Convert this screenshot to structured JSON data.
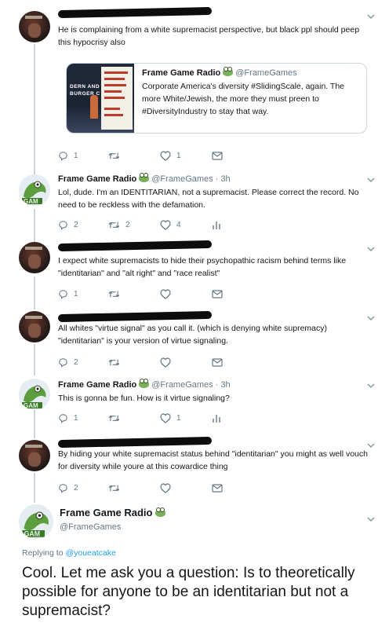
{
  "tweets": [
    {
      "text": "He is complaining from a white supremacist perspective, but black ppl should peep this hypocrisy also",
      "counts": {
        "reply": "1",
        "retweet": "",
        "like": "1"
      }
    },
    {
      "name": "Frame Game Radio",
      "handle": "@FrameGames · 3h",
      "text": "Lol, dude. I'm an IDENTITARIAN, not a supremacist. Please correct the record. No need to be reckless with the defamation.",
      "counts": {
        "reply": "2",
        "retweet": "2",
        "like": "4"
      }
    },
    {
      "text": "I expect white supremacists to hide their psychopathic racism behind terms like \"identitarian\" and \"alt right\" and \"race realist\"",
      "counts": {
        "reply": "1",
        "retweet": "",
        "like": ""
      }
    },
    {
      "text": "All whites \"virtue signal\" as you call it. (which is denying white supremacy) \"identitarian\" is your version of virtue signaling.",
      "counts": {
        "reply": "2",
        "retweet": "",
        "like": ""
      }
    },
    {
      "name": "Frame Game Radio",
      "handle": "@FrameGames · 3h",
      "text": "This is gonna be fun. How is it virtue signaling?",
      "counts": {
        "reply": "1",
        "retweet": "",
        "like": "1"
      }
    },
    {
      "text": "By hiding your white supremacist status behind \"identitarian\" you might as well vouch for diversity while youre at this cowardice thing",
      "counts": {
        "reply": "2",
        "retweet": "",
        "like": ""
      }
    }
  ],
  "quote": {
    "name": "Frame Game Radio",
    "handle": "@FrameGames",
    "text": "Corporate America's diversity #SlidingScale, again. The more White/Jewish, the more they must preen to #DiversityIndustry to stay that way.",
    "image_text_1": "DERN AND",
    "image_text_2": "BURGER C"
  },
  "main": {
    "name": "Frame Game Radio",
    "handle": "@FrameGames",
    "replying_prefix": "Replying to",
    "replying_to": "@youeatcake",
    "text": "Cool. Let me ask you a question: Is to theoretically possible for anyone to be an identitarian but not a supremacist?"
  },
  "icons": {
    "reply": "reply-icon",
    "retweet": "retweet-icon",
    "like": "heart-icon",
    "message": "envelope-icon",
    "analytics": "analytics-icon",
    "more": "chevron-down-icon",
    "emoji": "frog-emoji"
  },
  "colors": {
    "text": "#14171a",
    "secondary": "#657786",
    "link": "#1da1f2",
    "border": "#ccd6dd"
  }
}
